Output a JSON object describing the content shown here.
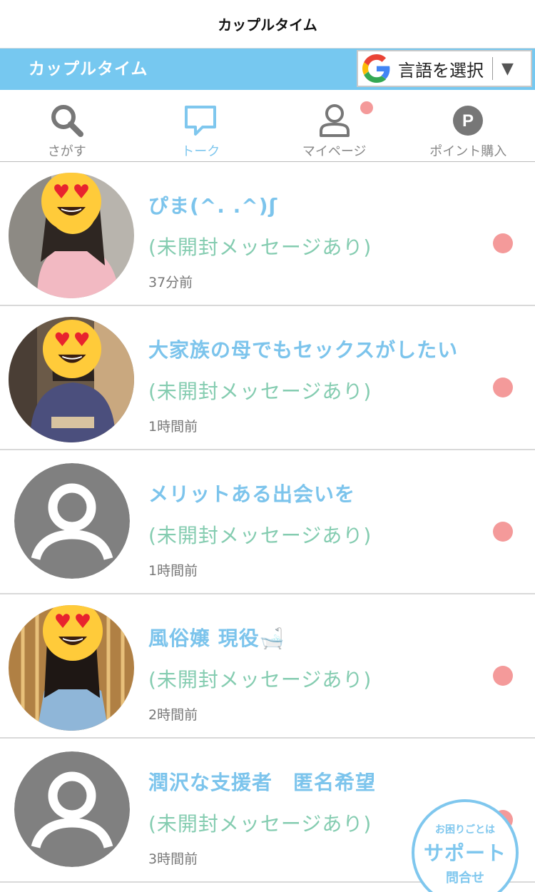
{
  "app": {
    "title": "カップルタイム"
  },
  "header": {
    "brand": "カップルタイム",
    "language_selector": {
      "label": "言語を選択",
      "arrow": "▼"
    }
  },
  "nav": {
    "items": [
      {
        "label": "さがす",
        "icon": "search-icon"
      },
      {
        "label": "トーク",
        "icon": "chat-bubble-icon",
        "active": true
      },
      {
        "label": "マイページ",
        "icon": "person-icon",
        "has_notification": true
      },
      {
        "label": "ポイント購入",
        "icon": "points-p-icon"
      }
    ]
  },
  "conversations": [
    {
      "name": "ぴま(^. .^)ʃ",
      "status": "(未開封メッセージあり)",
      "time": "37分前",
      "avatar": "photo-heart-eyes",
      "unread": true
    },
    {
      "name": "大家族の母でもセックスがしたい",
      "status": "(未開封メッセージあり)",
      "time": "1時間前",
      "avatar": "photo-heart-eyes",
      "unread": true
    },
    {
      "name": "メリットある出会いを",
      "status": "(未開封メッセージあり)",
      "time": "1時間前",
      "avatar": "default-user",
      "unread": true
    },
    {
      "name": "風俗嬢 現役🛁",
      "status": "(未開封メッセージあり)",
      "time": "2時間前",
      "avatar": "photo-heart-eyes",
      "unread": true
    },
    {
      "name": "潤沢な支援者　匿名希望",
      "status": "(未開封メッセージあり)",
      "time": "3時間前",
      "avatar": "default-user",
      "unread": true
    }
  ],
  "support": {
    "line1": "お困りごとは",
    "line2": "サポート",
    "line3": "問合せ"
  },
  "colors": {
    "accent": "#76c8f0",
    "unread_dot": "#f49a9a",
    "status_text": "#84ccb0",
    "name_text": "#7cc4ec"
  }
}
